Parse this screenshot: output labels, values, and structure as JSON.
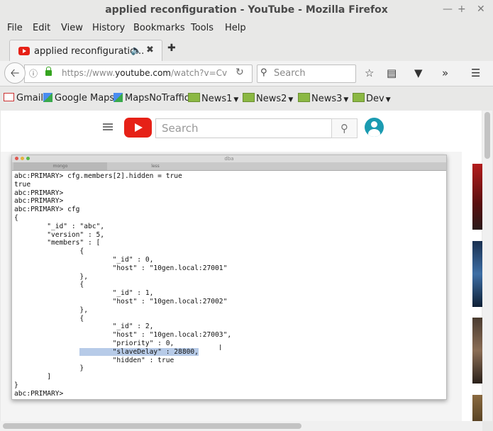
{
  "window": {
    "title": "applied reconfiguration - YouTube - Mozilla Firefox"
  },
  "menu": [
    "File",
    "Edit",
    "View",
    "History",
    "Bookmarks",
    "Tools",
    "Help"
  ],
  "tab": {
    "label": "applied reconfiguratio..."
  },
  "url": {
    "prefix": "https://www.",
    "domain": "youtube.com",
    "suffix": "/watch?v=Cv"
  },
  "search": {
    "placeholder": "Search"
  },
  "bookmarks": [
    {
      "label": "Gmail"
    },
    {
      "label": "Google Maps"
    },
    {
      "label": "MapsNoTraffic"
    },
    {
      "label": "News1"
    },
    {
      "label": "News2"
    },
    {
      "label": "News3"
    },
    {
      "label": "Dev"
    }
  ],
  "youtube": {
    "search_placeholder": "Search"
  },
  "terminal": {
    "window_title": "dba",
    "tabs": [
      "mongo",
      "less"
    ],
    "before": "abc:PRIMARY> cfg.members[2].hidden = true\ntrue\nabc:PRIMARY>\nabc:PRIMARY>\nabc:PRIMARY> cfg\n{\n        \"_id\" : \"abc\",\n        \"version\" : 5,\n        \"members\" : [\n                {\n                        \"_id\" : 0,\n                        \"host\" : \"10gen.local:27001\"\n                },\n                {\n                        \"_id\" : 1,\n                        \"host\" : \"10gen.local:27002\"\n                },\n                {\n                        \"_id\" : 2,\n                        \"host\" : \"10gen.local:27003\",\n                        \"priority\" : 0,\n",
    "highlight_indent": "                ",
    "highlight": "        \"slaveDelay\" : 28800,",
    "after": "\n                        \"hidden\" : true\n                }\n        ]\n}\nabc:PRIMARY>"
  },
  "colors": {
    "youtube_red": "#e62117",
    "accent_green": "#36a420"
  }
}
